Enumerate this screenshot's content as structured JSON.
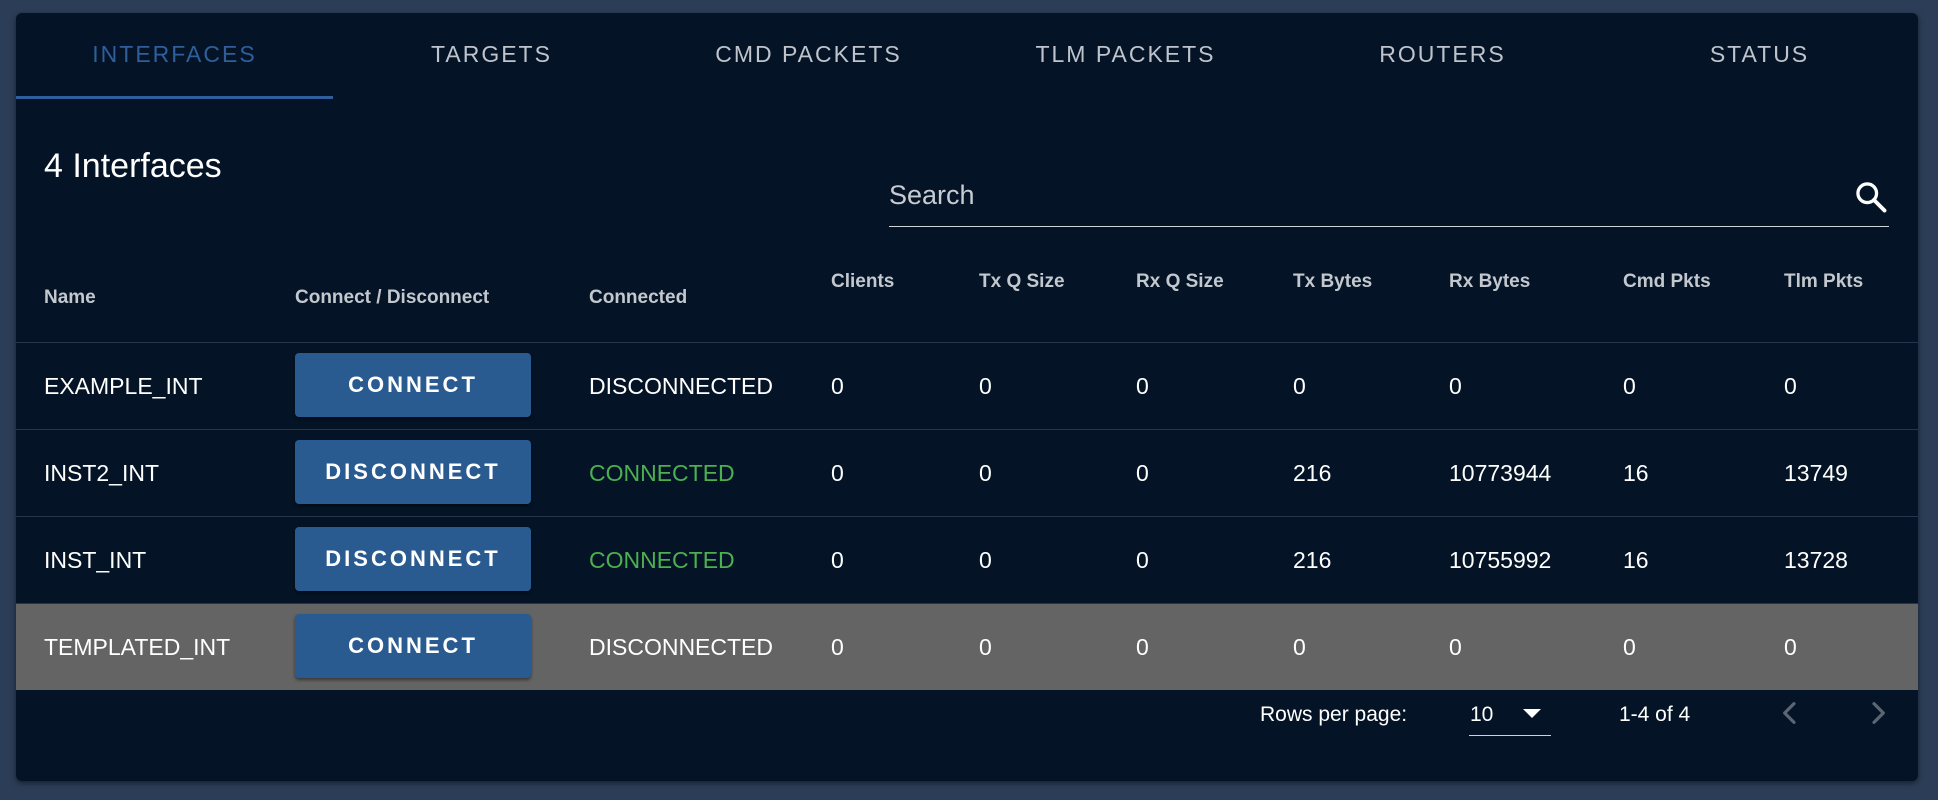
{
  "tabs": [
    "INTERFACES",
    "TARGETS",
    "CMD PACKETS",
    "TLM PACKETS",
    "ROUTERS",
    "STATUS"
  ],
  "active_tab": "INTERFACES",
  "title": "4 Interfaces",
  "search": {
    "placeholder": "Search",
    "value": ""
  },
  "columns": {
    "name": "Name",
    "connect": "Connect / Disconnect",
    "connected": "Connected",
    "clients": "Clients",
    "txq": "Tx Q Size",
    "rxq": "Rx Q Size",
    "txb": "Tx Bytes",
    "rxb": "Rx Bytes",
    "cmd": "Cmd Pkts",
    "tlm": "Tlm Pkts"
  },
  "rows": [
    {
      "name": "EXAMPLE_INT",
      "action": "CONNECT",
      "connected": "DISCONNECTED",
      "clients": "0",
      "txq": "0",
      "rxq": "0",
      "txb": "0",
      "rxb": "0",
      "cmd": "0",
      "tlm": "0"
    },
    {
      "name": "INST2_INT",
      "action": "DISCONNECT",
      "connected": "CONNECTED",
      "clients": "0",
      "txq": "0",
      "rxq": "0",
      "txb": "216",
      "rxb": "10773944",
      "cmd": "16",
      "tlm": "13749"
    },
    {
      "name": "INST_INT",
      "action": "DISCONNECT",
      "connected": "CONNECTED",
      "clients": "0",
      "txq": "0",
      "rxq": "0",
      "txb": "216",
      "rxb": "10755992",
      "cmd": "16",
      "tlm": "13728"
    },
    {
      "name": "TEMPLATED_INT",
      "action": "CONNECT",
      "connected": "DISCONNECTED",
      "clients": "0",
      "txq": "0",
      "rxq": "0",
      "txb": "0",
      "rxb": "0",
      "cmd": "0",
      "tlm": "0"
    }
  ],
  "selected_row": 3,
  "footer": {
    "rows_per_page_label": "Rows per page:",
    "rows_per_page": "10",
    "range": "1-4 of 4"
  },
  "colors": {
    "background": "#2c3d57",
    "card": "#041426",
    "accent": "#2f5e9c",
    "button": "#295b91",
    "connected": "#4caf50",
    "selected_row": "#646464"
  },
  "icons": {
    "search": "search-icon",
    "prev": "chevron-left-icon",
    "next": "chevron-right-icon",
    "dropdown": "caret-down-icon"
  }
}
